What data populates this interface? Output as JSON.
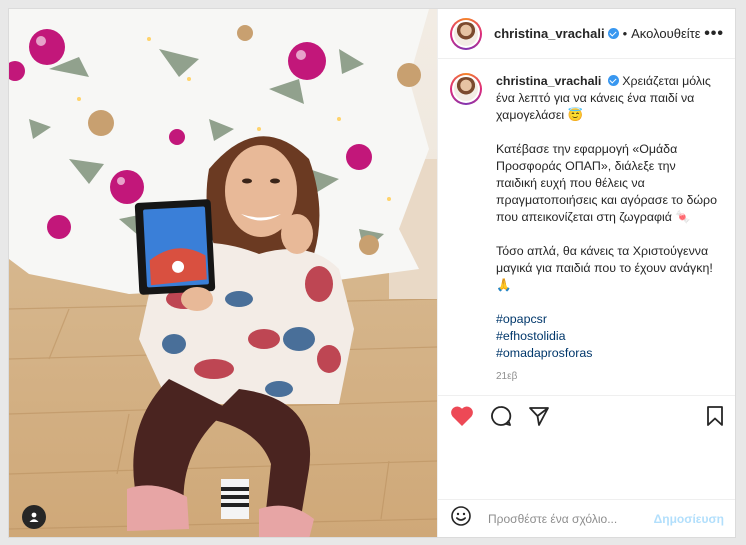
{
  "header": {
    "username": "christina_vrachali",
    "separator": "•",
    "follow_label": "Ακολουθείτε",
    "more_icon": "more-horizontal-icon"
  },
  "caption": {
    "username": "christina_vrachali",
    "line1": "Χρειάζεται μόλις ένα λεπτό για να κάνεις ένα παιδί να χαμογελάσει 😇",
    "line2": "Κατέβασε την εφαρμογή «Ομάδα Προσφοράς ΟΠΑΠ», διάλεξε την παιδική ευχή που θέλεις να πραγματοποιήσεις και αγόρασε το δώρο που απεικονίζεται στη ζωγραφιά 🍬",
    "line3": "Τόσο απλά, θα κάνεις τα Χριστούγεννα μαγικά για παιδιά που το έχουν ανάγκη! 🙏",
    "hashtags": [
      "#opapcsr",
      "#efhostolidia",
      "#omadaprosforas"
    ],
    "timestamp": "21εβ"
  },
  "actions": {
    "like_icon": "heart-filled-icon",
    "comment_icon": "comment-icon",
    "share_icon": "share-icon",
    "save_icon": "bookmark-icon",
    "like_color": "#ed4956"
  },
  "add_comment": {
    "emoji_icon": "smiley-icon",
    "placeholder": "Προσθέστε ένα σχόλιο...",
    "post_label": "Δημοσίευση"
  },
  "photo": {
    "user_tag_icon": "user-tag-icon",
    "description_colors": {
      "ornament": "#c2177a",
      "floor": "#d2ad7e"
    }
  }
}
